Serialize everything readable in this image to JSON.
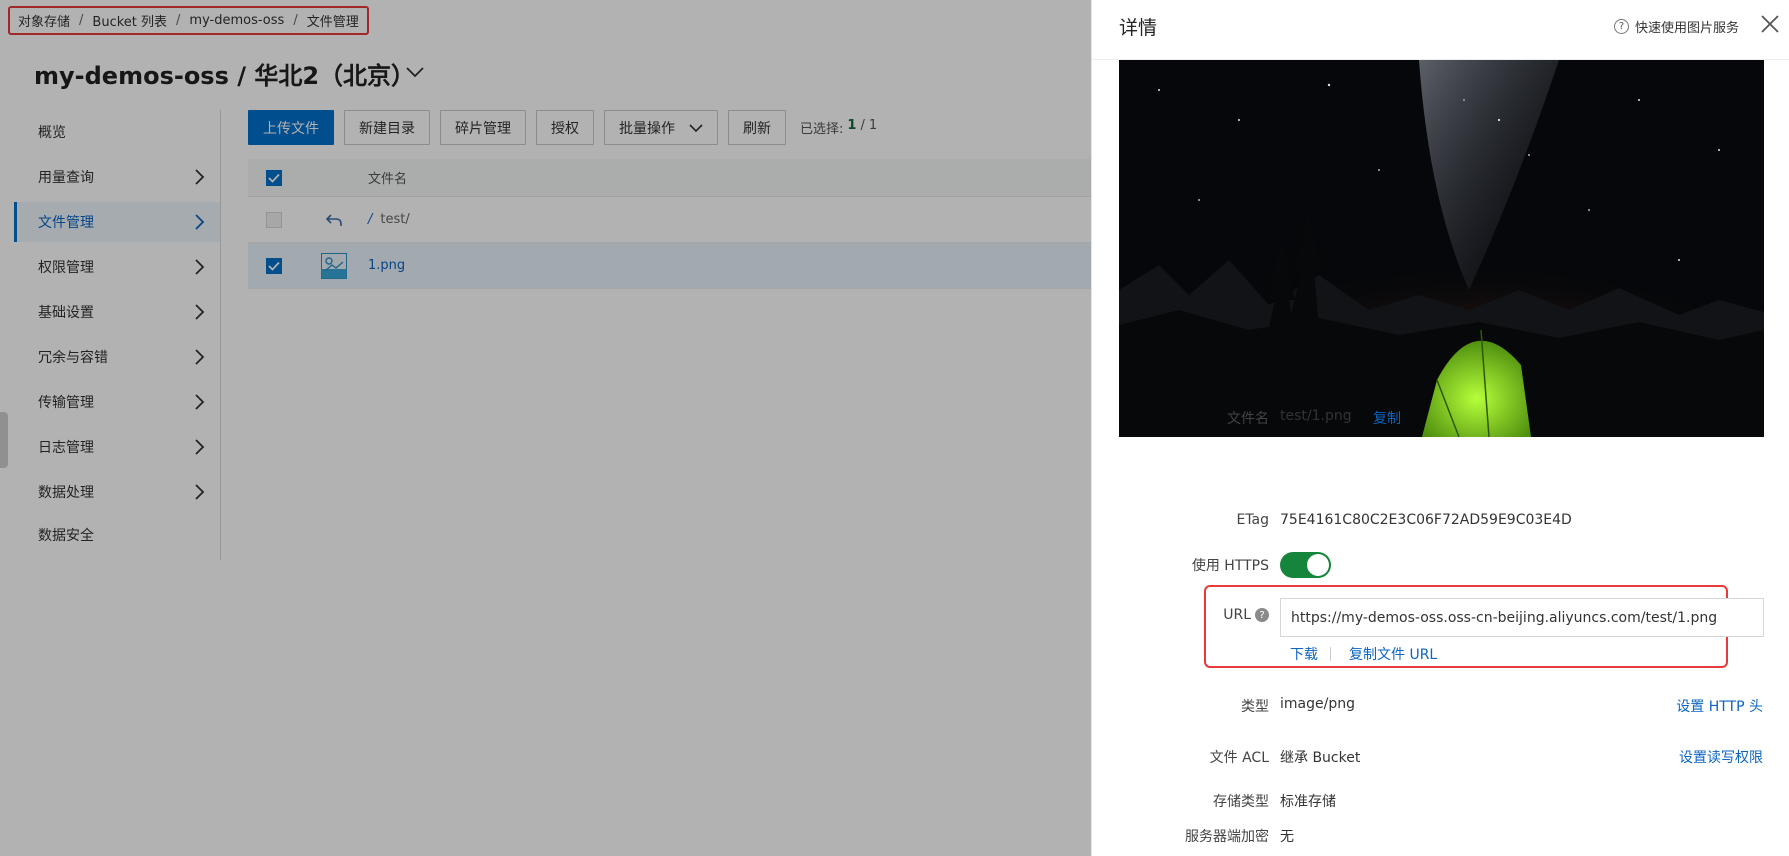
{
  "breadcrumb": {
    "items": [
      "对象存储",
      "Bucket 列表",
      "my-demos-oss",
      "文件管理"
    ],
    "separator": "/"
  },
  "page": {
    "title": "my-demos-oss / 华北2（北京）"
  },
  "sidebar": {
    "items": [
      {
        "label": "概览",
        "has_chevron": false
      },
      {
        "label": "用量查询",
        "has_chevron": true
      },
      {
        "label": "文件管理",
        "has_chevron": true,
        "active": true
      },
      {
        "label": "权限管理",
        "has_chevron": true
      },
      {
        "label": "基础设置",
        "has_chevron": true
      },
      {
        "label": "冗余与容错",
        "has_chevron": true
      },
      {
        "label": "传输管理",
        "has_chevron": true
      },
      {
        "label": "日志管理",
        "has_chevron": true
      },
      {
        "label": "数据处理",
        "has_chevron": true
      },
      {
        "label": "数据安全",
        "has_chevron": false
      }
    ]
  },
  "toolbar": {
    "upload": "上传文件",
    "new_dir": "新建目录",
    "fragments": "碎片管理",
    "authorize": "授权",
    "batch": "批量操作",
    "refresh": "刷新",
    "selected_label": "已选择:",
    "selected_count": "1",
    "selected_sep": "/",
    "selected_total": "1"
  },
  "table": {
    "header_name": "文件名",
    "rows": [
      {
        "type": "parent",
        "slash": "/",
        "name": "test/"
      },
      {
        "type": "file",
        "name": "1.png",
        "checked": true
      }
    ]
  },
  "drawer": {
    "title": "详情",
    "help": "快速使用图片服务",
    "fields": {
      "filename_label": "文件名",
      "filename_value": "test/1.png",
      "copy_link": "复制",
      "etag_label": "ETag",
      "etag_value": "75E4161C80C2E3C06F72AD59E9C03E4D",
      "https_label": "使用 HTTPS",
      "https_enabled": true,
      "url_label": "URL",
      "url_value": "https://my-demos-oss.oss-cn-beijing.aliyuncs.com/test/1.png",
      "download": "下载",
      "copy_url": "复制文件 URL",
      "type_label": "类型",
      "type_value": "image/png",
      "set_http_header": "设置 HTTP 头",
      "acl_label": "文件 ACL",
      "acl_value": "继承 Bucket",
      "set_acl": "设置读写权限",
      "storage_label": "存储类型",
      "storage_value": "标准存储",
      "encryption_label": "服务器端加密",
      "encryption_value": "无"
    }
  },
  "colors": {
    "primary": "#0070cc",
    "highlight_border": "#e83a3a",
    "toggle_on": "#16853c",
    "selected_count": "#0d6b3e"
  }
}
